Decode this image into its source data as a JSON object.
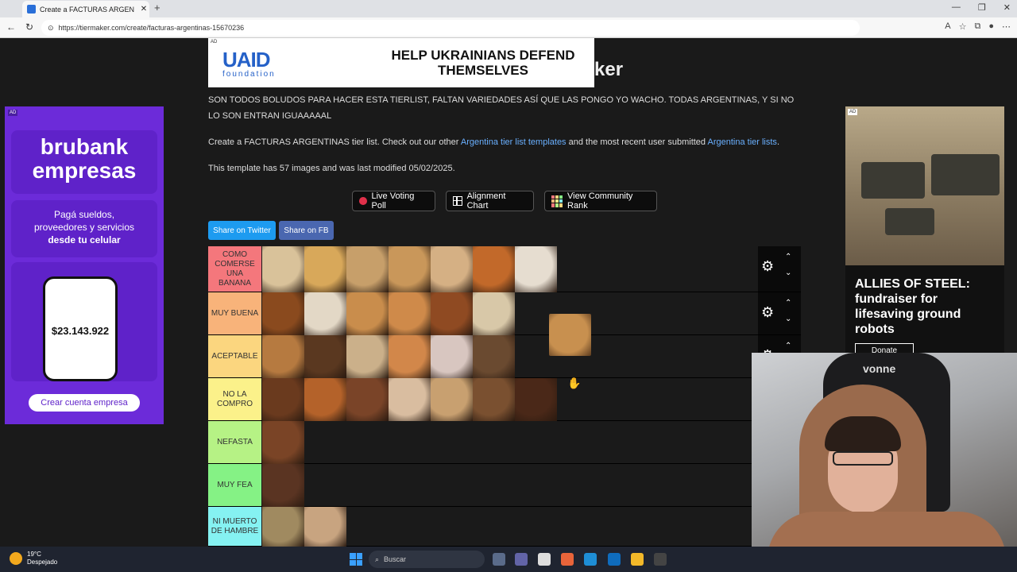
{
  "browser": {
    "tab_title": "Create a FACTURAS ARGENTINAS",
    "url": "https://tiermaker.com/create/facturas-argentinas-15670236",
    "new_tab": "+",
    "window_controls": [
      "—",
      "❐",
      "✕"
    ]
  },
  "top_ad": {
    "ad_label": "AD",
    "logo_main": "UAID",
    "logo_sub": "foundation",
    "message": "HELP UKRAINIANS DEFEND THEMSELVES"
  },
  "page": {
    "title_fragment": "ker",
    "description": "SON TODOS BOLUDOS PARA HACER ESTA TIERLIST, FALTAN VARIEDADES ASÍ QUE LAS PONGO YO WACHO. TODAS ARGENTINAS, Y SI NO LO SON ENTRAN IGUAAAAAL",
    "create_prefix": "Create a FACTURAS ARGENTINAS tier list. Check out our other ",
    "create_link1": "Argentina tier list templates",
    "create_middle": " and the most recent user submitted ",
    "create_link2": "Argentina tier lists",
    "create_suffix": ".",
    "template_info": "This template has 57 images and was last modified 05/02/2025."
  },
  "buttons": {
    "live_poll": "Live Voting Poll",
    "alignment": "Alignment Chart",
    "community_rank": "View Community Rank",
    "share_twitter": "Share on Twitter",
    "share_fb": "Share on FB"
  },
  "tiers": [
    {
      "label": "COMO COMERSE UNA BANANA",
      "color": "#f4777c",
      "items": [
        "#d9c29a",
        "#d8a85a",
        "#c79f6a",
        "#c9975a",
        "#d5b084",
        "#c2692a",
        "#e6ddd0"
      ]
    },
    {
      "label": "MUY BUENA",
      "color": "#f8b37a",
      "items": [
        "#8a4a1e",
        "#e3d8c6",
        "#c98d4c",
        "#cf8a4a",
        "#8f4a22",
        "#d8c8a8"
      ]
    },
    {
      "label": "ACEPTABLE",
      "color": "#fbd67f",
      "items": [
        "#b67a40",
        "#5a3820",
        "#cbb08a",
        "#d2874a",
        "#d8c6c0",
        "#6a4a30"
      ]
    },
    {
      "label": "NO LA COMPRO",
      "color": "#fbf18a",
      "items": [
        "#6a3a1e",
        "#b4622a",
        "#7a4428",
        "#d9bda0",
        "#c8a070",
        "#7a5030",
        "#4a2818"
      ]
    },
    {
      "label": "NEFASTA",
      "color": "#b6f285",
      "items": [
        "#7a4426"
      ]
    },
    {
      "label": "MUY FEA",
      "color": "#85f285",
      "items": [
        "#5a3422"
      ]
    },
    {
      "label": "NI MUERTO DE HAMBRE",
      "color": "#85f2f2",
      "items": [
        "#a08a60",
        "#c8a480"
      ]
    }
  ],
  "dragged_item_color": "#c8904f",
  "tier_controls": {
    "gear": "⚙",
    "up": "⌃",
    "down": "⌄"
  },
  "left_ad": {
    "ad_label": "AD",
    "brand": "brubank empresas",
    "tagline_1": "Pagá sueldos,",
    "tagline_2": "proveedores y servicios",
    "tagline_3": "desde tu celular",
    "balance": "$23.143.922",
    "cta": "Crear cuenta empresa"
  },
  "right_ad": {
    "ad_label": "AD",
    "headline": "ALLIES OF STEEL: fundraiser for lifesaving ground robots",
    "donate": "Donate"
  },
  "webcam": {
    "chair_text": "vonne"
  },
  "taskbar": {
    "temperature": "19°C",
    "condition": "Despejado",
    "search_placeholder": "Buscar"
  }
}
